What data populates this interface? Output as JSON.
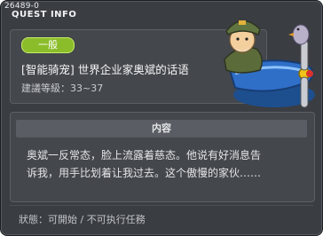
{
  "window": {
    "quest_id": "26489-0",
    "title": "QUEST INFO"
  },
  "quest": {
    "category_badge": "一般",
    "name": "[智能骑宠] 世界企业家奥斌的话语",
    "level_text": "建議等級：33~37",
    "section_title": "内容",
    "content_line_1": "奥斌一反常态，脸上流露着慈态。他说有好消息告",
    "content_line_2": "诉我，用手比划着让我过去。这个傲慢的家伙……",
    "status_text": "狀態：可開始 / 不可执行任務"
  },
  "colors": {
    "panel_bg": "#3a3d42",
    "card_bg": "#44474c",
    "badge_green": "#8bbd2a"
  },
  "icons": {
    "npc": "npc-pilot-plane-illustration"
  }
}
